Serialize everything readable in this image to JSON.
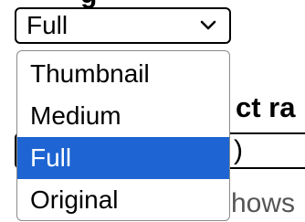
{
  "background_heading_fragment": "g",
  "size_select": {
    "value": "Full",
    "chevron_icon": "chevron-down-icon",
    "options": [
      {
        "label": "Thumbnail",
        "selected": false
      },
      {
        "label": "Medium",
        "selected": false
      },
      {
        "label": "Full",
        "selected": true
      },
      {
        "label": "Original",
        "selected": false
      }
    ]
  },
  "underlying": {
    "heading_fragment": "ct ra",
    "field_fragment": ")",
    "hint_fragment": "hows"
  },
  "colors": {
    "selected_option_bg": "#1e64d2",
    "selected_option_text": "#ffffff",
    "border": "#000000"
  }
}
